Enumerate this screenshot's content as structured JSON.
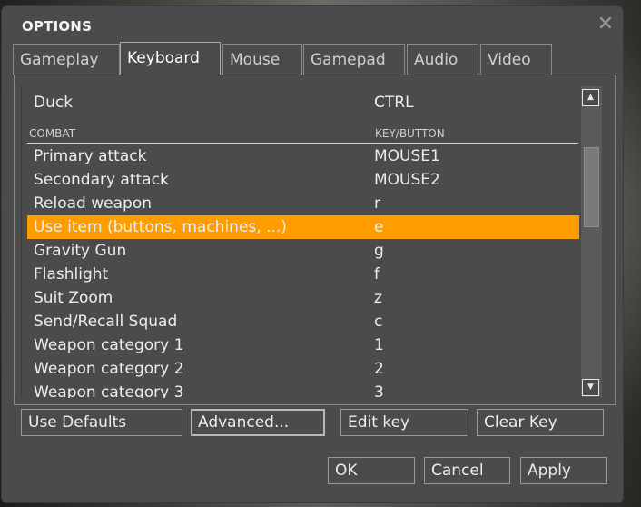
{
  "dialog": {
    "title": "OPTIONS",
    "close_glyph": "✕"
  },
  "tabs": [
    {
      "label": "Gameplay",
      "active": false
    },
    {
      "label": "Keyboard",
      "active": true
    },
    {
      "label": "Mouse",
      "active": false
    },
    {
      "label": "Gamepad",
      "active": false
    },
    {
      "label": "Audio",
      "active": false
    },
    {
      "label": "Video",
      "active": false
    }
  ],
  "keylist": {
    "top_row": {
      "action": "Duck",
      "key": "CTRL"
    },
    "section": {
      "header_action": "COMBAT",
      "header_key": "KEY/BUTTON"
    },
    "rows": [
      {
        "action": "Primary attack",
        "key": "MOUSE1"
      },
      {
        "action": "Secondary attack",
        "key": "MOUSE2"
      },
      {
        "action": "Reload weapon",
        "key": "r"
      },
      {
        "action": "Use item (buttons, machines, ...)",
        "key": "e",
        "selected": true
      },
      {
        "action": "Gravity Gun",
        "key": "g"
      },
      {
        "action": "Flashlight",
        "key": "f"
      },
      {
        "action": "Suit Zoom",
        "key": "z"
      },
      {
        "action": "Send/Recall Squad",
        "key": "c"
      },
      {
        "action": "Weapon category 1",
        "key": "1"
      },
      {
        "action": "Weapon category 2",
        "key": "2"
      },
      {
        "action": "Weapon category 3",
        "key": "3"
      }
    ],
    "selected_color": "#ff9c00"
  },
  "scrollbar": {
    "up_icon": "▲",
    "down_icon": "▼"
  },
  "actions": {
    "use_defaults": "Use Defaults",
    "advanced": "Advanced...",
    "edit_key": "Edit key",
    "clear_key": "Clear Key"
  },
  "footer": {
    "ok": "OK",
    "cancel": "Cancel",
    "apply": "Apply"
  }
}
